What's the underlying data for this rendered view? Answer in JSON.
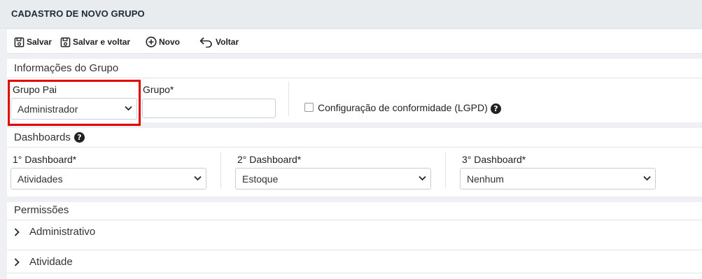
{
  "page": {
    "title": "CADASTRO DE NOVO GRUPO"
  },
  "toolbar": {
    "save": {
      "label": "Salvar",
      "icon": "floppy-disk-icon"
    },
    "save_back": {
      "label": "Salvar e voltar",
      "icon": "floppy-disk-icon"
    },
    "new": {
      "label": "Novo",
      "icon": "plus-circle-icon"
    },
    "back": {
      "label": "Voltar",
      "icon": "undo-arrow-icon"
    }
  },
  "group_info": {
    "title": "Informações do Grupo",
    "parent_group": {
      "label": "Grupo Pai",
      "value": "Administrador",
      "highlighted": true
    },
    "group": {
      "label": "Grupo*",
      "value": ""
    },
    "compliance": {
      "label": "Configuração de conformidade (LGPD)",
      "checked": false
    }
  },
  "dashboards": {
    "title": "Dashboards",
    "first": {
      "label": "1° Dashboard*",
      "value": "Atividades"
    },
    "second": {
      "label": "2° Dashboard*",
      "value": "Estoque"
    },
    "third": {
      "label": "3° Dashboard*",
      "value": "Nenhum"
    }
  },
  "permissions": {
    "title": "Permissões",
    "sections": [
      {
        "label": "Administrativo",
        "expanded": false
      },
      {
        "label": "Atividade",
        "expanded": false
      }
    ]
  },
  "colors": {
    "highlight": "#e00000",
    "background": "#eef0f3",
    "header": "#e9ecef"
  }
}
